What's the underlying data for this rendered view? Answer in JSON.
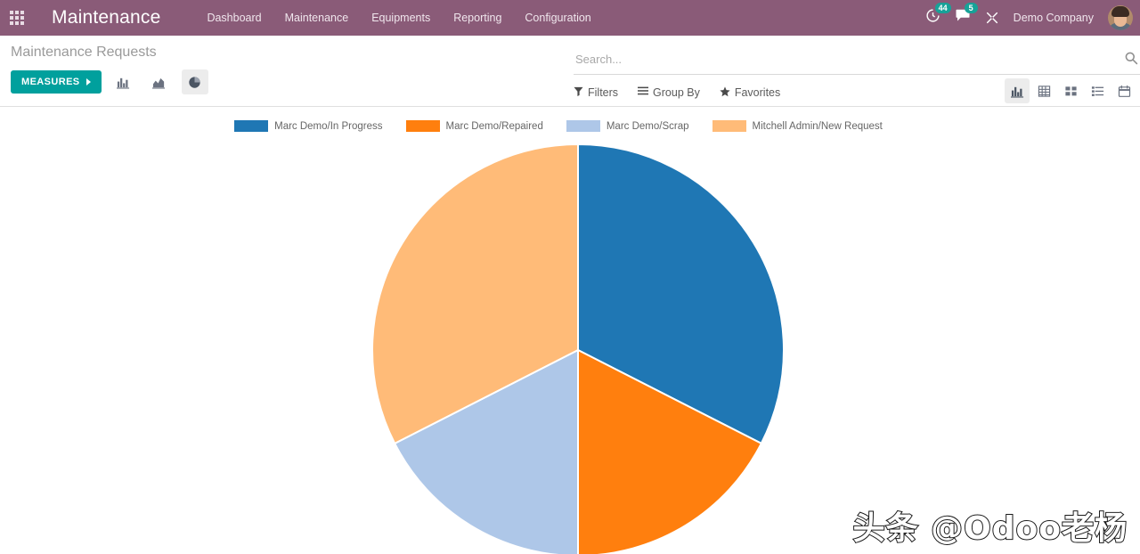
{
  "navbar": {
    "apps_icon": "apps-grid-icon",
    "brand": "Maintenance",
    "menu": [
      {
        "label": "Dashboard"
      },
      {
        "label": "Maintenance"
      },
      {
        "label": "Equipments"
      },
      {
        "label": "Reporting"
      },
      {
        "label": "Configuration"
      }
    ],
    "activities": {
      "icon": "clock-activity-icon",
      "count": "44"
    },
    "messages": {
      "icon": "chat-bubble-icon",
      "count": "5"
    },
    "debug": {
      "icon": "bug-wrench-icon"
    },
    "company": "Demo Company",
    "avatar": "user-avatar",
    "background_color": "#8a5b78"
  },
  "control_panel": {
    "breadcrumb": "Maintenance Requests",
    "measures_label": "MEASURES",
    "measures_color": "#00a09d",
    "chart_toggles": [
      {
        "name": "bar-chart-icon",
        "active": false
      },
      {
        "name": "line-chart-icon",
        "active": false
      },
      {
        "name": "pie-chart-icon",
        "active": true
      }
    ],
    "search": {
      "placeholder": "Search...",
      "value": "",
      "icon": "search-icon"
    },
    "filters": [
      {
        "label": "Filters",
        "icon": "funnel-icon"
      },
      {
        "label": "Group By",
        "icon": "hamburger-icon"
      },
      {
        "label": "Favorites",
        "icon": "star-icon"
      }
    ],
    "views": [
      {
        "name": "graph-view-icon",
        "active": true
      },
      {
        "name": "pivot-view-icon",
        "active": false
      },
      {
        "name": "kanban-view-icon",
        "active": false
      },
      {
        "name": "list-view-icon",
        "active": false
      },
      {
        "name": "calendar-view-icon",
        "active": false
      }
    ]
  },
  "watermark": "头条 @Odoo老杨",
  "chart_data": {
    "type": "pie",
    "title": "",
    "legend_position": "top",
    "labels": [
      "Marc Demo/In Progress",
      "Marc Demo/Repaired",
      "Marc Demo/Scrap",
      "Mitchell Admin/New Request"
    ],
    "values": [
      32.5,
      17.5,
      17.5,
      32.5
    ],
    "colors": [
      "#1f77b4",
      "#ff7f0e",
      "#aec7e8",
      "#ffbb78"
    ],
    "start_angle_deg": 0,
    "direction": "clockwise",
    "center": [
      649,
      393
    ],
    "radius": 231
  }
}
